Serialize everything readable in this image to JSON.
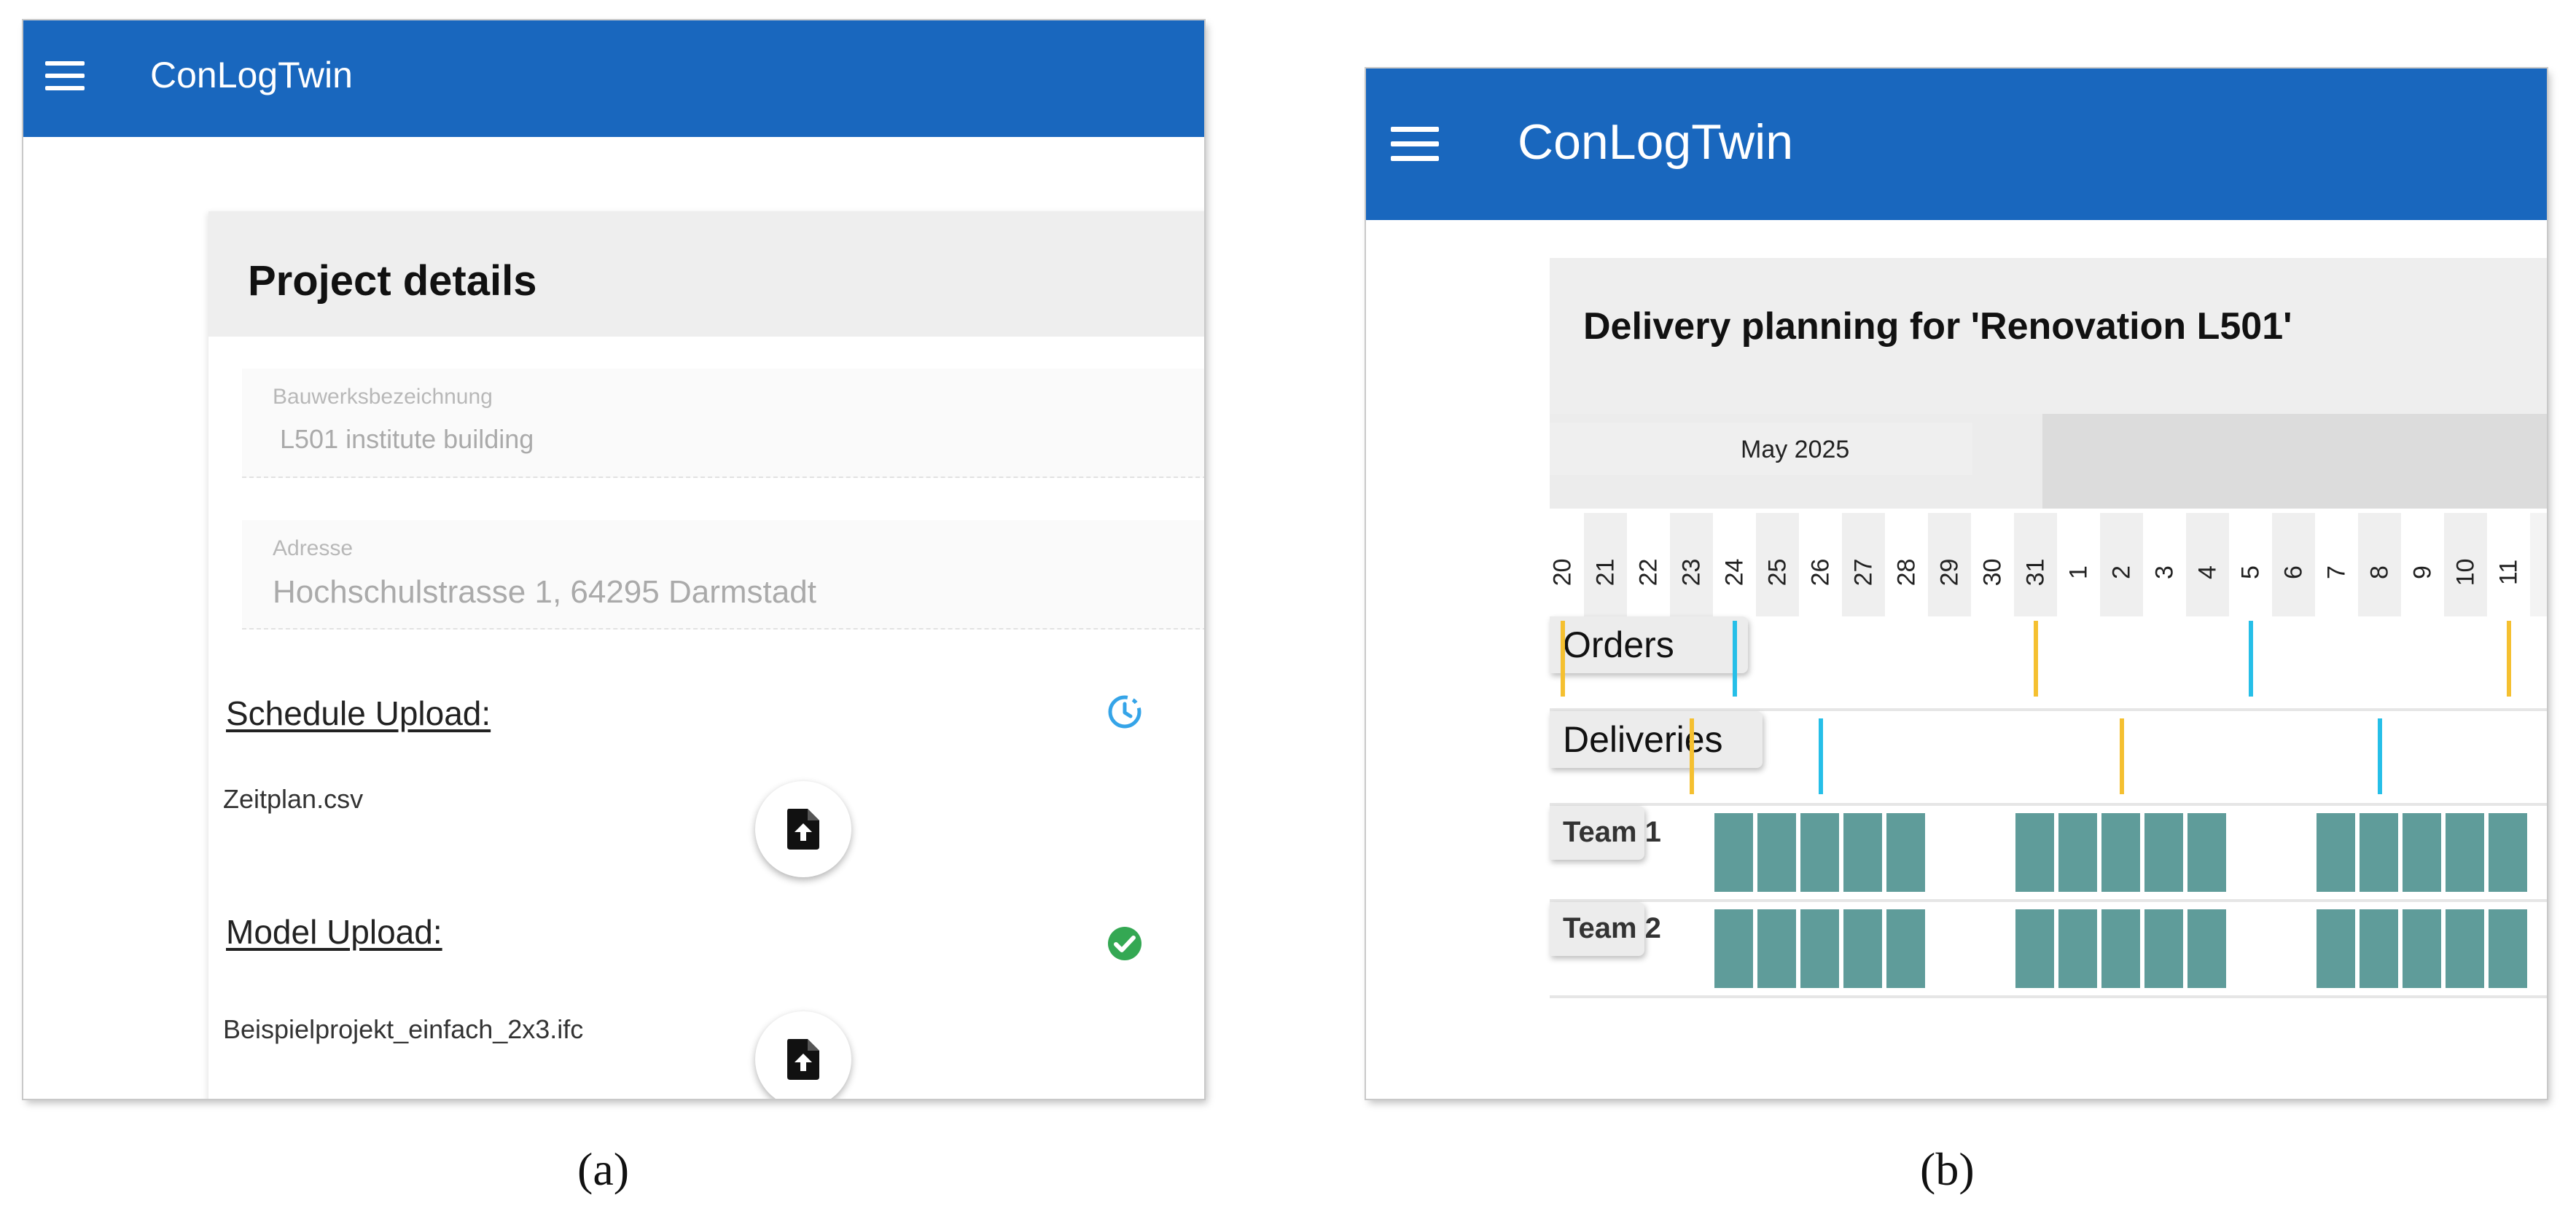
{
  "panel_a": {
    "app_title": "ConLogTwin",
    "menu_icon": "menu-icon",
    "card_title": "Project details",
    "fields": [
      {
        "label": "Bauwerksbezeichnung",
        "value": "L501 institute building"
      },
      {
        "label": "Adresse",
        "value": "Hochschulstrasse 1, 64295 Darmstadt"
      }
    ],
    "schedule": {
      "label": "Schedule Upload:",
      "file": "Zeitplan.csv",
      "status_icon": "history-icon",
      "upload_icon": "file-upload-icon"
    },
    "model": {
      "label": "Model Upload:",
      "file": "Beispielprojekt_einfach_2x3.ifc",
      "status_icon": "check-circle-icon",
      "upload_icon": "file-upload-icon"
    },
    "colors": {
      "appbar": "#1967be",
      "status_pending": "#35a4e8",
      "status_ok": "#34a853"
    }
  },
  "panel_b": {
    "app_title": "ConLogTwin",
    "menu_icon": "menu-icon",
    "plan_title": "Delivery planning for 'Renovation L501'",
    "month": "May 2025",
    "days": [
      "20",
      "21",
      "22",
      "23",
      "24",
      "25",
      "26",
      "27",
      "28",
      "29",
      "30",
      "31",
      "1",
      "2",
      "3",
      "4",
      "5",
      "6",
      "7",
      "8",
      "9",
      "10",
      "11"
    ],
    "lanes": {
      "orders": "Orders",
      "deliveries": "Deliveries",
      "team1": "Team 1",
      "team2": "Team 2"
    },
    "orders_markers": [
      {
        "day": "20",
        "color": "#f5c030"
      },
      {
        "day": "24",
        "color": "#26bfe8"
      },
      {
        "day": "31",
        "color": "#f5c030"
      },
      {
        "day": "5",
        "color": "#26bfe8"
      },
      {
        "day": "11",
        "color": "#f5c030"
      }
    ],
    "deliveries_markers": [
      {
        "day": "23",
        "color": "#f5c030"
      },
      {
        "day": "26",
        "color": "#26bfe8"
      },
      {
        "day": "2",
        "color": "#f5c030"
      },
      {
        "day": "8",
        "color": "#26bfe8"
      }
    ],
    "team_work_days": [
      "24",
      "25",
      "26",
      "27",
      "28",
      "31",
      "1",
      "2",
      "3",
      "4",
      "7",
      "8",
      "9",
      "10",
      "11"
    ],
    "colors": {
      "appbar": "#1967be",
      "work_block": "#5f9c9a"
    }
  },
  "captions": {
    "a": "(a)",
    "b": "(b)"
  }
}
